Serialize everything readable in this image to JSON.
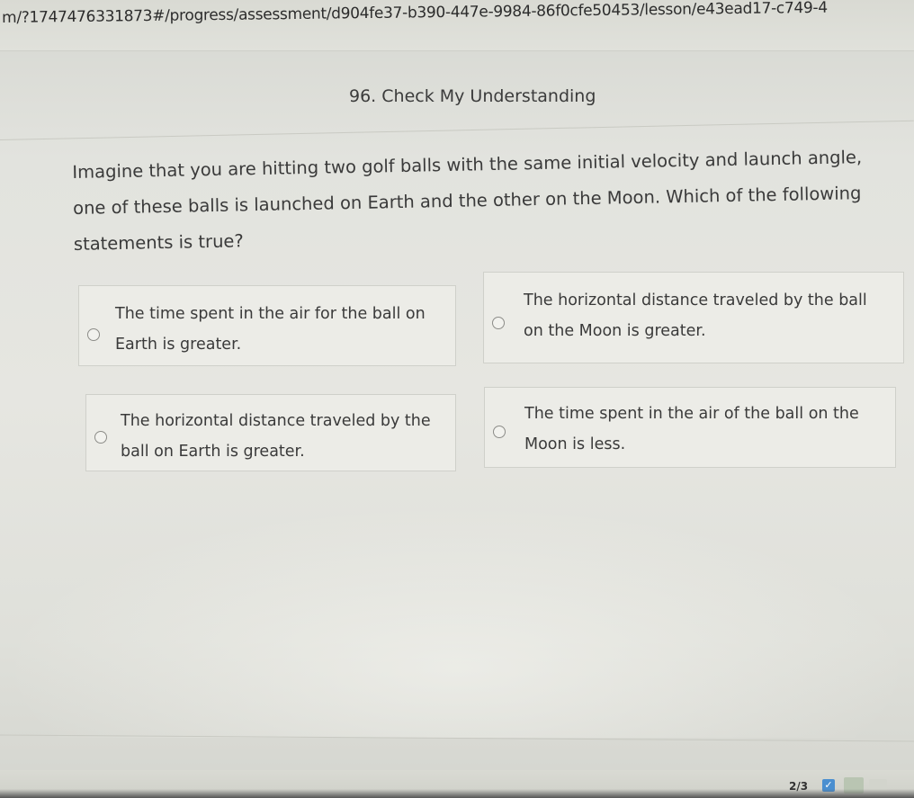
{
  "browser": {
    "url": "m/?1747476331873#/progress/assessment/d904fe37-b390-447e-9984-86f0cfe50453/lesson/e43ead17-c749-4"
  },
  "header": {
    "title": "96. Check My Understanding"
  },
  "question": {
    "text": "Imagine that you are hitting two golf balls with the same initial velocity and launch angle, one of these balls is launched on Earth and the other on the Moon. Which of the following statements is true?"
  },
  "options": [
    {
      "label": "The time spent in the air for the ball on Earth is greater.",
      "selected": false
    },
    {
      "label": "The horizontal distance traveled by the ball on the Moon is greater.",
      "selected": false
    },
    {
      "label": "The horizontal distance traveled by the ball on Earth is greater.",
      "selected": false
    },
    {
      "label": "The time spent in the air of the ball on the Moon is less.",
      "selected": false
    }
  ],
  "footer": {
    "page_indicator": "2/3",
    "check_icon": "check-icon",
    "check_glyph": "✓",
    "accent_color": "#4a8fd0"
  }
}
